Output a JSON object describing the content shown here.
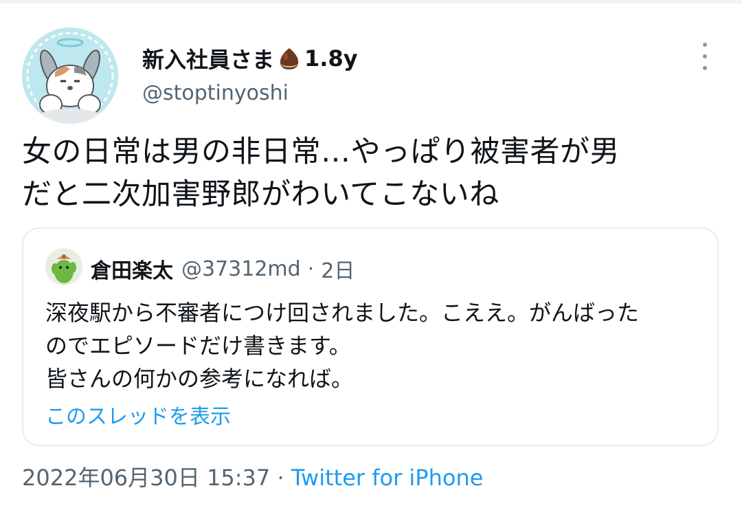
{
  "tweet": {
    "author": {
      "name": "新入社員さま",
      "badge_icon": "chestnut-icon",
      "badge_text": "1.8y",
      "handle": "@stoptinyoshi"
    },
    "text_lines": [
      "女の日常は男の非日常…やっぱり被害者が男",
      "だと二次加害野郎がわいてこないね"
    ],
    "quote": {
      "author_name": "倉田楽太",
      "handle": "@37312md",
      "separator": "·",
      "time": "2日",
      "text_lines": [
        "深夜駅から不審者につけ回されました。こええ。がんばった",
        "のでエピソードだけ書きます。",
        "皆さんの何かの参考になれば。"
      ],
      "show_thread": "このスレッドを表示"
    },
    "timestamp": "2022年06月30日 15:37",
    "separator": "·",
    "source": "Twitter for iPhone"
  },
  "colors": {
    "text": "#0f1419",
    "muted": "#536471",
    "link": "#1d9bf0",
    "border": "#e6ecf0"
  }
}
